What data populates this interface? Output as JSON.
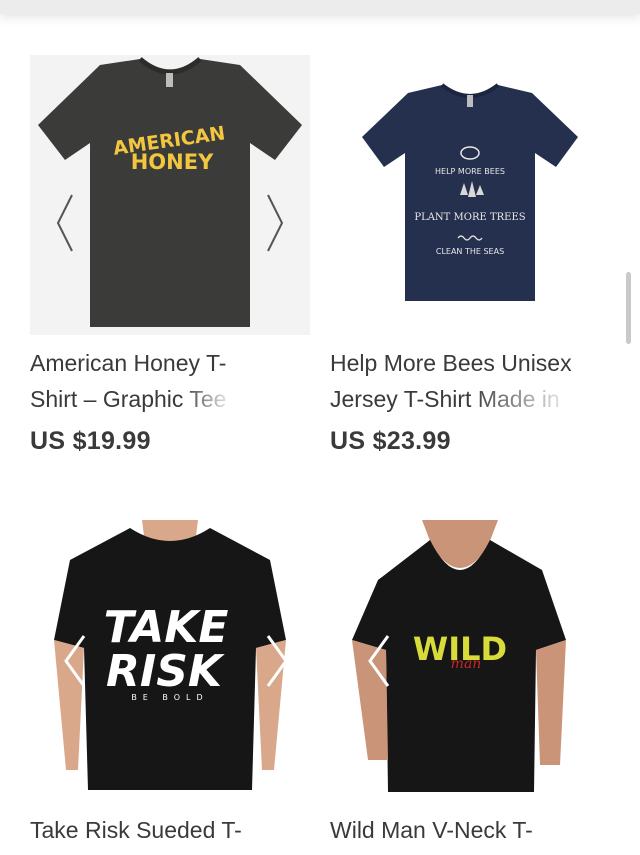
{
  "products": [
    {
      "title_line1": "American Honey T-",
      "title_line2_visible": "Shirt – Graphic",
      "title_line2_faded": " Tee",
      "price": "US $19.99",
      "art_line1": "AMERICAN",
      "art_line2": "HONEY"
    },
    {
      "title_line1": "Help More Bees Unisex",
      "title_line2_visible": "Jersey T-Shirt",
      "title_line2_faded": " Made in",
      "price": "US $23.99",
      "art_line1": "HELP MORE BEES",
      "art_line2": "PLANT MORE TREES",
      "art_line3": "CLEAN THE SEAS"
    },
    {
      "title_line1": "Take Risk Sueded T-",
      "art_line1": "TAKE",
      "art_line2": "RISK",
      "art_line3": "BE  BOLD"
    },
    {
      "title_line1": "Wild Man V-Neck T-",
      "art_line1": "WILD",
      "art_line2": "man"
    }
  ],
  "colors": {
    "charcoal_tee": "#3b3b39",
    "navy_tee": "#25304f",
    "black_tee": "#161616",
    "honey_yellow": "#f3c640",
    "wild_yellow": "#d8dc3a",
    "wild_red": "#c8242a"
  },
  "icons": [
    "chevron-left-icon",
    "chevron-right-icon"
  ]
}
